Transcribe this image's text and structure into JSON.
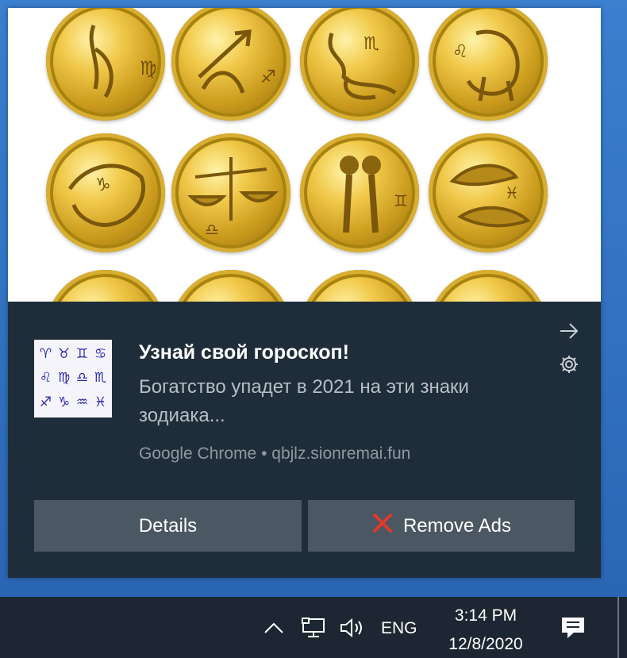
{
  "notification": {
    "title": "Узнай свой гороскоп!",
    "body": "Богатство упадет в 2021 на эти знаки зодиака...",
    "attribution": "Google Chrome • qbjlz.sionremai.fun",
    "app_icon_glyphs": [
      "♈",
      "♉",
      "♊",
      "♋",
      "♌",
      "♍",
      "♎",
      "♏",
      "♐",
      "♑",
      "♒",
      "♓"
    ],
    "hero_signs": [
      "♍",
      "♐",
      "♏",
      "♌",
      "♑",
      "♎",
      "♊",
      "♓"
    ],
    "buttons": {
      "details": "Details",
      "remove_ads": "Remove Ads"
    },
    "icons": {
      "dismiss": "arrow-right-icon",
      "settings": "gear-icon",
      "remove": "red-x-icon"
    }
  },
  "taskbar": {
    "language": "ENG",
    "time": "3:14 PM",
    "date": "12/8/2020",
    "icons": [
      "chevron-up-icon",
      "network-icon",
      "volume-icon",
      "action-center-icon"
    ]
  },
  "colors": {
    "toast_bg": "#1f2d3a",
    "button_bg": "#4b5763",
    "taskbar_bg": "#1c2733",
    "desktop_bg": "#2d6fbf",
    "remove_x": "#e0392b"
  }
}
